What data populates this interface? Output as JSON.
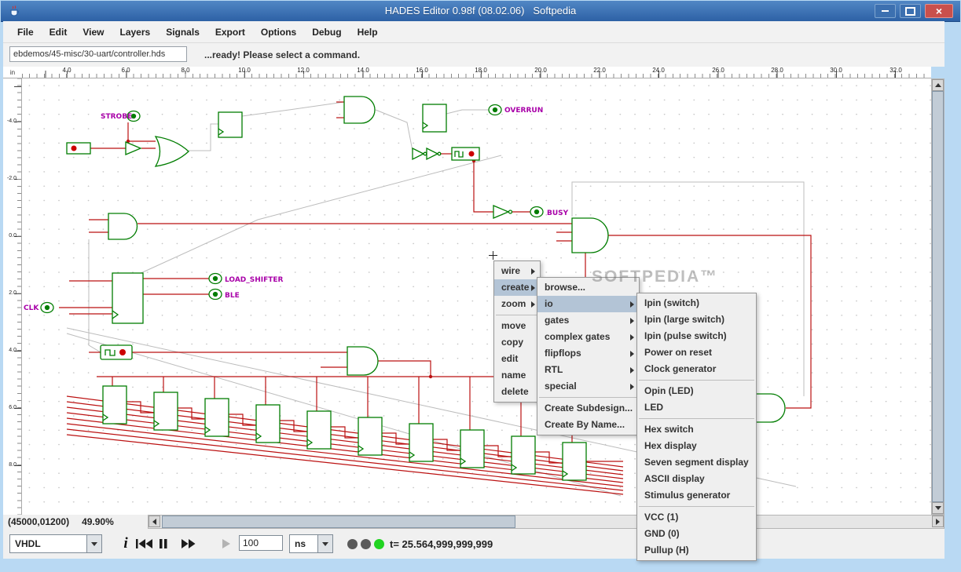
{
  "window": {
    "title": "HADES Editor 0.98f (08.02.06)   Softpedia"
  },
  "menubar": {
    "items": [
      "File",
      "Edit",
      "View",
      "Layers",
      "Signals",
      "Export",
      "Options",
      "Debug",
      "Help"
    ]
  },
  "toolbar": {
    "path_value": "ebdemos/45-misc/30-uart/controller.hds",
    "status_text": "...ready! Please select a command."
  },
  "rulers": {
    "unit_label": "in",
    "horizontal_ticks": [
      "4.0",
      "6.0",
      "8.0",
      "10.0",
      "12.0",
      "14.0",
      "16.0",
      "18.0",
      "20.0",
      "22.0",
      "24.0",
      "26.0",
      "28.0",
      "30.0",
      "32.0"
    ],
    "vertical_ticks": [
      "-4.0",
      "-2.0",
      "0.0",
      "2.0",
      "4.0",
      "6.0",
      "8.0"
    ]
  },
  "circuit_labels": {
    "strobe": "STROBE",
    "overrun": "OVERRUN",
    "busy": "BUSY",
    "load_shifter": "LOAD_SHIFTER",
    "ble": "BLE",
    "clk": "CLK"
  },
  "context_menu": {
    "items": [
      {
        "label": "wire"
      },
      {
        "label": "create"
      },
      {
        "label": "zoom"
      },
      {
        "label": "move"
      },
      {
        "label": "copy"
      },
      {
        "label": "edit"
      },
      {
        "label": "name"
      },
      {
        "label": "delete"
      }
    ]
  },
  "create_submenu": {
    "items": [
      {
        "label": "browse..."
      },
      {
        "label": "io"
      },
      {
        "label": "gates"
      },
      {
        "label": "complex gates"
      },
      {
        "label": "flipflops"
      },
      {
        "label": "RTL"
      },
      {
        "label": "special"
      },
      {
        "label": "Create Subdesign..."
      },
      {
        "label": "Create By Name..."
      }
    ]
  },
  "io_submenu": {
    "items": [
      "Ipin (switch)",
      "Ipin (large switch)",
      "Ipin (pulse switch)",
      "Power on reset",
      "Clock generator",
      "Opin (LED)",
      "LED",
      "Hex switch",
      "Hex display",
      "Seven segment display",
      "ASCII display",
      "Stimulus generator",
      "VCC (1)",
      "GND (0)",
      "Pullup (H)"
    ]
  },
  "watermark": "SOFTPEDIA™",
  "scrollbar_status": {
    "coordinates": "(45000,01200)",
    "zoom_level": "49.90%"
  },
  "bottom_toolbar": {
    "mode_select": "VHDL",
    "interval_value": "100",
    "unit_select": "ns",
    "time_text": "t= 25.564,999,999,999"
  }
}
